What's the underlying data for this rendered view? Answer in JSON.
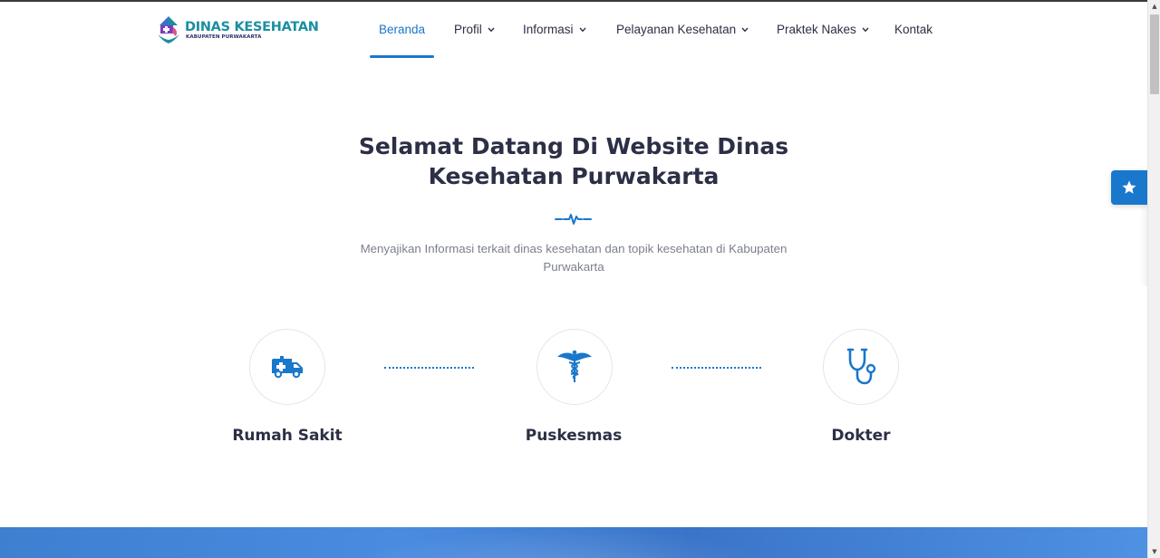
{
  "brand": {
    "title": "DINAS KESEHATAN",
    "subtitle": "KABUPATEN PURWAKARTA",
    "colors": {
      "primary": "#1977cc",
      "title_teal": "#1b8fa0",
      "dark_text": "#2c2f45",
      "muted_text": "#7b7f8e"
    }
  },
  "nav": {
    "items": [
      {
        "label": "Beranda",
        "has_dropdown": false,
        "active": true
      },
      {
        "label": "Profil",
        "has_dropdown": true,
        "active": false
      },
      {
        "label": "Informasi",
        "has_dropdown": true,
        "active": false
      },
      {
        "label": "Pelayanan Kesehatan",
        "has_dropdown": true,
        "active": false
      },
      {
        "label": "Praktek Nakes",
        "has_dropdown": true,
        "active": false
      },
      {
        "label": "Kontak",
        "has_dropdown": false,
        "active": false
      }
    ],
    "chevron_glyph": "⌄"
  },
  "hero": {
    "title_line1": "Selamat Datang Di Website Dinas",
    "title_line2": "Kesehatan Purwakarta",
    "description_line1": "Menyajikan Informasi terkait dinas kesehatan dan topik kesehatan di Kabupaten",
    "description_line2": "Purwakarta"
  },
  "services": [
    {
      "label": "Rumah Sakit",
      "icon": "ambulance-icon"
    },
    {
      "label": "Puskesmas",
      "icon": "caduceus-icon"
    },
    {
      "label": "Dokter",
      "icon": "stethoscope-icon"
    }
  ],
  "floating_button": {
    "icon": "star-icon"
  },
  "scrollbar": {
    "up_glyph": "▲",
    "down_glyph": "▼"
  }
}
